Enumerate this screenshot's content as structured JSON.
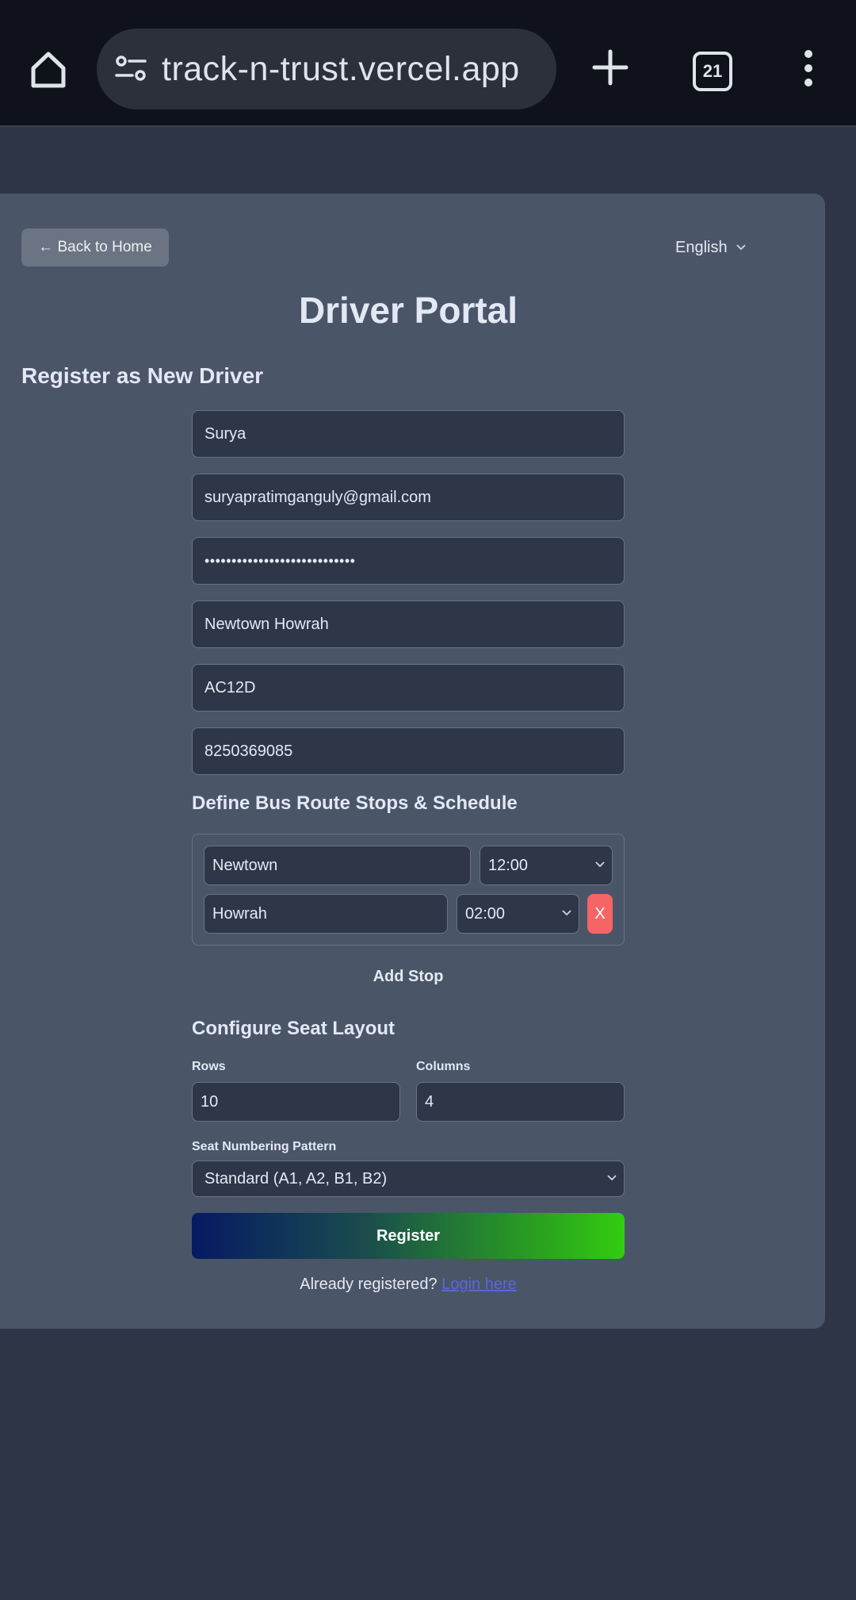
{
  "browser": {
    "url": "track-n-trust.vercel.app",
    "tab_count": "21"
  },
  "header": {
    "back_label": "← Back to Home",
    "language": "English",
    "title": "Driver Portal"
  },
  "form": {
    "section_title": "Register as New Driver",
    "name": "Surya",
    "email": "suryapratimganguly@gmail.com",
    "password_masked": "••••••••••••••••••••••••••••",
    "route": "Newtown Howrah",
    "bus_number": "AC12D",
    "phone": "8250369085"
  },
  "stops": {
    "title": "Define Bus Route Stops & Schedule",
    "items": [
      {
        "name": "Newtown",
        "time": "12:00"
      },
      {
        "name": "Howrah",
        "time": "02:00"
      }
    ],
    "remove_label": "X",
    "add_label": "Add Stop"
  },
  "seats": {
    "title": "Configure Seat Layout",
    "rows_label": "Rows",
    "rows_value": "10",
    "columns_label": "Columns",
    "columns_value": "4",
    "pattern_label": "Seat Numbering Pattern",
    "pattern_value": "Standard (A1, A2, B1, B2)"
  },
  "actions": {
    "register_label": "Register",
    "already_text": "Already registered?",
    "login_link": "Login here"
  },
  "colors": {
    "page_bg": "#2d3546",
    "card_bg": "#4a5568",
    "input_bg": "#2d3748",
    "danger": "#f56565",
    "link": "#5a67d8"
  }
}
